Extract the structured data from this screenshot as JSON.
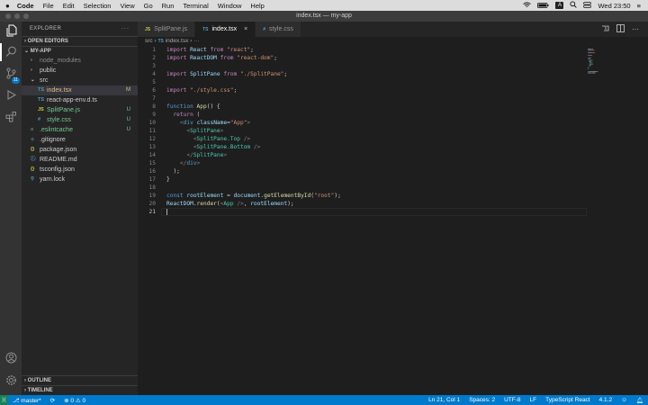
{
  "menubar": {
    "apple_icon": "apple-icon",
    "items": [
      "Code",
      "File",
      "Edit",
      "Selection",
      "View",
      "Go",
      "Run",
      "Terminal",
      "Window",
      "Help"
    ],
    "kbd_label": "A",
    "clock": "Wed 23:50"
  },
  "window": {
    "title": "index.tsx — my-app"
  },
  "sidebar": {
    "header": "EXPLORER",
    "more": "···",
    "open_editors": "OPEN EDITORS",
    "project": "MY-APP",
    "tree": [
      {
        "name": "node_modules",
        "icon": "›",
        "status": "",
        "indent": 1,
        "kind": "folder",
        "color": "#8b8b8b"
      },
      {
        "name": "public",
        "icon": "›",
        "status": "",
        "indent": 1,
        "kind": "folder",
        "color": "#cccccc"
      },
      {
        "name": "src",
        "icon": "⌄",
        "status": "",
        "indent": 1,
        "kind": "folder",
        "color": "#cccccc"
      },
      {
        "name": "index.tsx",
        "icon": "TS",
        "status": "M",
        "indent": 2,
        "kind": "file",
        "color": "#e2c08d",
        "iconColor": "#519aba",
        "selected": true
      },
      {
        "name": "react-app-env.d.ts",
        "icon": "TS",
        "status": "",
        "indent": 2,
        "kind": "file",
        "color": "#cccccc",
        "iconColor": "#519aba"
      },
      {
        "name": "SplitPane.js",
        "icon": "JS",
        "status": "U",
        "indent": 2,
        "kind": "file",
        "color": "#73c991",
        "iconColor": "#cbcb41"
      },
      {
        "name": "style.css",
        "icon": "#",
        "status": "U",
        "indent": 2,
        "kind": "file",
        "color": "#73c991",
        "iconColor": "#519aba"
      },
      {
        "name": ".eslintcache",
        "icon": "≡",
        "status": "U",
        "indent": 1,
        "kind": "file",
        "color": "#73c991",
        "iconColor": "#73c991"
      },
      {
        "name": ".gitignore",
        "icon": "◆",
        "status": "",
        "indent": 1,
        "kind": "file",
        "color": "#cccccc",
        "iconColor": "#41535b"
      },
      {
        "name": "package.json",
        "icon": "{}",
        "status": "",
        "indent": 1,
        "kind": "file",
        "color": "#cccccc",
        "iconColor": "#cbcb41"
      },
      {
        "name": "README.md",
        "icon": "ⓘ",
        "status": "",
        "indent": 1,
        "kind": "file",
        "color": "#cccccc",
        "iconColor": "#519aba"
      },
      {
        "name": "tsconfig.json",
        "icon": "{}",
        "status": "",
        "indent": 1,
        "kind": "file",
        "color": "#cccccc",
        "iconColor": "#cbcb41"
      },
      {
        "name": "yarn.lock",
        "icon": "⚲",
        "status": "",
        "indent": 1,
        "kind": "file",
        "color": "#cccccc",
        "iconColor": "#519aba"
      }
    ],
    "outline": "OUTLINE",
    "timeline": "TIMELINE"
  },
  "tabs": [
    {
      "label": "SplitPane.js",
      "icon": "JS",
      "iconColor": "#cbcb41",
      "active": false
    },
    {
      "label": "index.tsx",
      "icon": "TS",
      "iconColor": "#519aba",
      "active": true
    },
    {
      "label": "style.css",
      "icon": "#",
      "iconColor": "#519aba",
      "active": false
    }
  ],
  "breadcrumb": {
    "folder": "src",
    "sep": "›",
    "icon": "TS",
    "file": "index.tsx",
    "more": "···"
  },
  "code": [
    [
      [
        "import",
        "k"
      ],
      [
        " React ",
        "v"
      ],
      [
        "from",
        "k"
      ],
      [
        " \"react\"",
        "s"
      ],
      [
        ";",
        ""
      ]
    ],
    [
      [
        "import",
        "k"
      ],
      [
        " ReactDOM ",
        "v"
      ],
      [
        "from",
        "k"
      ],
      [
        " \"react-dom\"",
        "s"
      ],
      [
        ";",
        ""
      ]
    ],
    [],
    [
      [
        "import",
        "k"
      ],
      [
        " SplitPane ",
        "v"
      ],
      [
        "from",
        "k"
      ],
      [
        " \"./SplitPane\"",
        "s"
      ],
      [
        ";",
        ""
      ]
    ],
    [],
    [
      [
        "import",
        "k"
      ],
      [
        " \"./style.css\"",
        "s"
      ],
      [
        ";",
        ""
      ]
    ],
    [],
    [
      [
        "function",
        "b"
      ],
      [
        " ",
        ""
      ],
      [
        "App",
        "f"
      ],
      [
        "() {",
        ""
      ]
    ],
    [
      [
        "  ",
        ""
      ],
      [
        "return",
        "k"
      ],
      [
        " (",
        ""
      ]
    ],
    [
      [
        "    ",
        ""
      ],
      [
        "<",
        "g"
      ],
      [
        "div",
        "b"
      ],
      [
        " ",
        ""
      ],
      [
        "className",
        "v"
      ],
      [
        "=",
        ""
      ],
      [
        "\"App\"",
        "s"
      ],
      [
        ">",
        "g"
      ]
    ],
    [
      [
        "      ",
        ""
      ],
      [
        "<",
        "g"
      ],
      [
        "SplitPane",
        "t"
      ],
      [
        ">",
        "g"
      ]
    ],
    [
      [
        "        ",
        ""
      ],
      [
        "<",
        "g"
      ],
      [
        "SplitPane.Top",
        "t"
      ],
      [
        " />",
        "g"
      ]
    ],
    [
      [
        "        ",
        ""
      ],
      [
        "<",
        "g"
      ],
      [
        "SplitPane.Bottom",
        "t"
      ],
      [
        " />",
        "g"
      ]
    ],
    [
      [
        "      ",
        ""
      ],
      [
        "</",
        "g"
      ],
      [
        "SplitPane",
        "t"
      ],
      [
        ">",
        "g"
      ]
    ],
    [
      [
        "    ",
        ""
      ],
      [
        "</",
        "g"
      ],
      [
        "div",
        "b"
      ],
      [
        ">",
        "g"
      ]
    ],
    [
      [
        "  );",
        ""
      ]
    ],
    [
      [
        "}",
        ""
      ]
    ],
    [],
    [
      [
        "const",
        "b"
      ],
      [
        " ",
        ""
      ],
      [
        "rootElement",
        "v"
      ],
      [
        " = ",
        ""
      ],
      [
        "document",
        "v"
      ],
      [
        ".",
        ""
      ],
      [
        "getElementById",
        "f"
      ],
      [
        "(",
        ""
      ],
      [
        "\"root\"",
        "s"
      ],
      [
        ");",
        ""
      ]
    ],
    [
      [
        "ReactDOM",
        "v"
      ],
      [
        ".",
        ""
      ],
      [
        "render",
        "f"
      ],
      [
        "(",
        ""
      ],
      [
        "<",
        "g"
      ],
      [
        "App",
        "t"
      ],
      [
        " />",
        "g"
      ],
      [
        ", ",
        ""
      ],
      [
        "rootElement",
        "v"
      ],
      [
        ");",
        ""
      ]
    ],
    []
  ],
  "status": {
    "remote_icon": "remote-icon",
    "branch": "master*",
    "sync": "⟳",
    "errors": "0",
    "warnings": "0",
    "position": "Ln 21, Col 1",
    "spaces": "Spaces: 2",
    "encoding": "UTF-8",
    "eol": "LF",
    "language": "TypeScript React",
    "version": "4.1.2"
  },
  "colors": {
    "accent": "#007acc",
    "sidebar": "#252526",
    "editor": "#1e1e1e",
    "activity": "#333333"
  }
}
